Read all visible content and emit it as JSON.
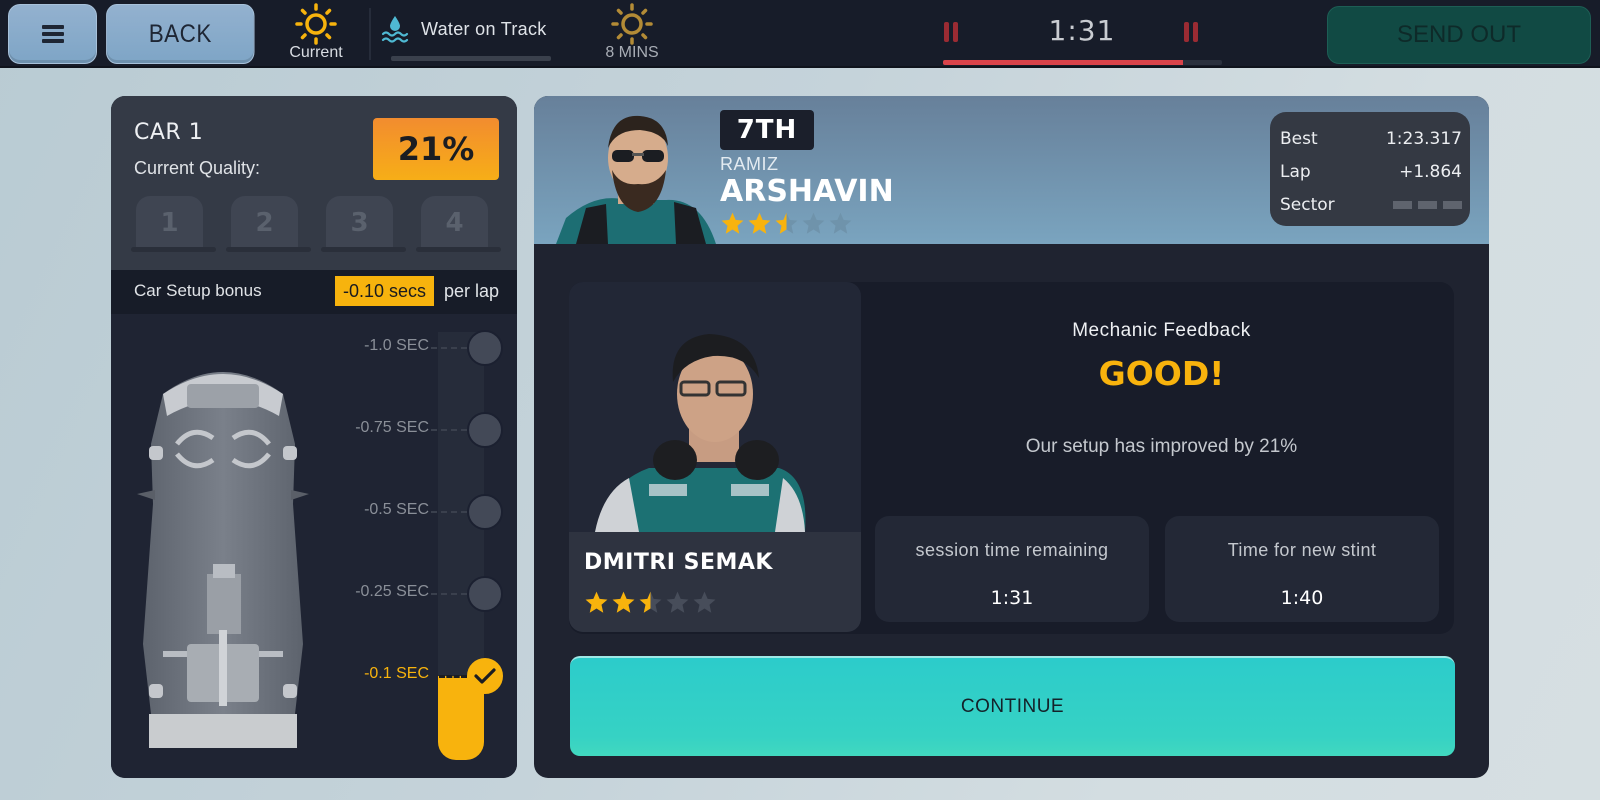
{
  "topbar": {
    "menu_icon": "hamburger-menu-icon",
    "back_label": "BACK",
    "weather_current": {
      "icon": "sun-icon",
      "label": "Current",
      "color": "#f7b30d"
    },
    "water": {
      "icon": "water-droplet-waves-icon",
      "label": "Water on Track",
      "level_percent": 0
    },
    "weather_forecast": {
      "icon": "sun-icon",
      "label": "8 MINS",
      "color": "#b38b36"
    },
    "timer": {
      "value": "1:31",
      "progress_percent": 86,
      "pause_icon": "pause-icon",
      "color": "#d9434a"
    },
    "send_out_label": "SEND OUT"
  },
  "car_panel": {
    "title": "CAR 1",
    "quality_label": "Current Quality:",
    "quality_value": "21%",
    "slots": [
      "1",
      "2",
      "3",
      "4"
    ],
    "bonus_label": "Car Setup bonus",
    "bonus_value": "-0.10 secs",
    "bonus_suffix": "per lap",
    "setup_levels": [
      {
        "label": "-1.0 SEC",
        "active": false
      },
      {
        "label": "-0.75 SEC",
        "active": false
      },
      {
        "label": "-0.5 SEC",
        "active": false
      },
      {
        "label": "-0.25 SEC",
        "active": false
      },
      {
        "label": "-0.1 SEC",
        "active": true
      }
    ],
    "selected_level": "-0.1 SEC",
    "car_image": "car-top-view-image"
  },
  "driver": {
    "position": "7TH",
    "first_name": "RAMIZ",
    "last_name": "ARSHAVIN",
    "rating": 2.5,
    "rating_max": 5,
    "portrait": "driver-portrait-image",
    "lap_info": {
      "best_label": "Best",
      "best_value": "1:23.317",
      "lap_label": "Lap",
      "lap_value": "+1.864",
      "sector_label": "Sector",
      "sector_segments": 3
    }
  },
  "mechanic": {
    "name": "DMITRI SEMAK",
    "rating": 2.5,
    "rating_max": 5,
    "portrait": "mechanic-portrait-image"
  },
  "feedback": {
    "title": "Mechanic Feedback",
    "grade": "GOOD!",
    "message": "Our setup has improved by 21%"
  },
  "stats": [
    {
      "label": "session time remaining",
      "value": "1:31"
    },
    {
      "label": "Time for new stint",
      "value": "1:40"
    }
  ],
  "continue_label": "CONTINUE",
  "colors": {
    "accent_yellow": "#f8b30d",
    "accent_teal": "#33cfc6",
    "timer_red": "#d9434a",
    "send_out_green": "#114a44"
  }
}
